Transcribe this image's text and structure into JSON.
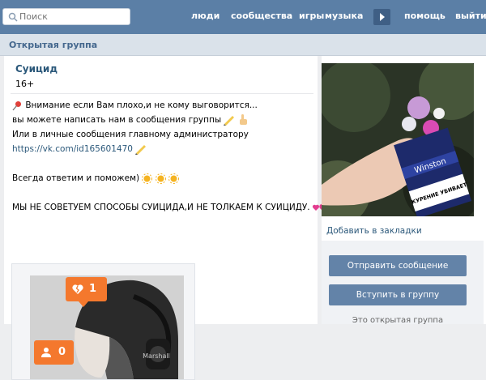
{
  "topbar": {
    "search_placeholder": "Поиск",
    "nav": [
      "люди",
      "сообщества",
      "игры",
      "музыка",
      "помощь",
      "выйти"
    ]
  },
  "header": {
    "title": "Открытая группа"
  },
  "group": {
    "name": "Суицид",
    "age": "16+",
    "description": {
      "line1": "Внимание если Вам плохо,и не кому выговорится...",
      "line2": "вы можете написать нам в сообщения группы",
      "line3": "Или в личные сообщения главному администратору",
      "link": "https://vk.com/id165601470",
      "line5": "Всегда ответим и поможем)",
      "line6": "МЫ НЕ СОВЕТУЕМ СПОСОБЫ СУИЦИДА,И НЕ ТОЛКАЕМ К СУИЦИДУ."
    },
    "post_image": {
      "badge_broken_hearts": "1",
      "badge_followers": "0",
      "headphone_brand": "Marshall"
    }
  },
  "sidebar": {
    "avatar_pack_brand": "Winston",
    "avatar_pack_warning": "КУРЕНИЕ УБИВАЕТ",
    "bookmark_link": "Добавить в закладки",
    "send_message_button": "Отправить сообщение",
    "join_button": "Вступить в группу",
    "status_text": "Это открытая группа"
  },
  "colors": {
    "topbar": "#5b7fa6",
    "button": "#6383a8",
    "link": "#2b587a",
    "badge": "#f4782d"
  }
}
